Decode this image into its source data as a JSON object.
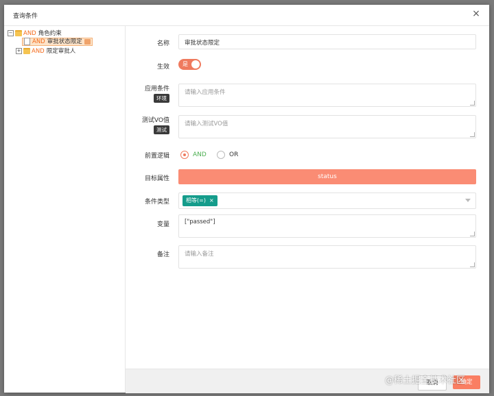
{
  "modal": {
    "title": "查询条件",
    "close_glyph": "×"
  },
  "tree": {
    "root": {
      "keyword": "AND",
      "label": "角色约束",
      "toggle": "⊟"
    },
    "children": [
      {
        "keyword": "AND",
        "label": "审批状态限定",
        "selected": true
      },
      {
        "keyword": "AND",
        "label": "限定审批人",
        "toggle": "⊞"
      }
    ]
  },
  "form": {
    "name": {
      "label": "名称",
      "value": "审批状态限定"
    },
    "enabled": {
      "label": "生效",
      "switch_text": "是",
      "on": true
    },
    "condition": {
      "label": "应用条件",
      "tag": "环境",
      "placeholder": "请输入应用条件"
    },
    "test_vo": {
      "label": "测试VO值",
      "tag": "测试",
      "placeholder": "请输入测试VO值"
    },
    "logic": {
      "label": "前置逻辑",
      "options": [
        "AND",
        "OR"
      ],
      "selected": "AND"
    },
    "target": {
      "label": "目标属性",
      "value": "status"
    },
    "cond_type": {
      "label": "条件类型",
      "chip": "相等(=)",
      "chip_close": "×"
    },
    "variable": {
      "label": "变量",
      "value": "[\"passed\"]"
    },
    "remark": {
      "label": "备注",
      "placeholder": "请输入备注"
    }
  },
  "footer": {
    "cancel_label": "取消",
    "ok_label": "确定"
  },
  "watermark": "@稀土掘金技术社区",
  "colors": {
    "accent": "#fa8c74",
    "chip": "#149c8b",
    "keyword": "#f46a1a"
  }
}
